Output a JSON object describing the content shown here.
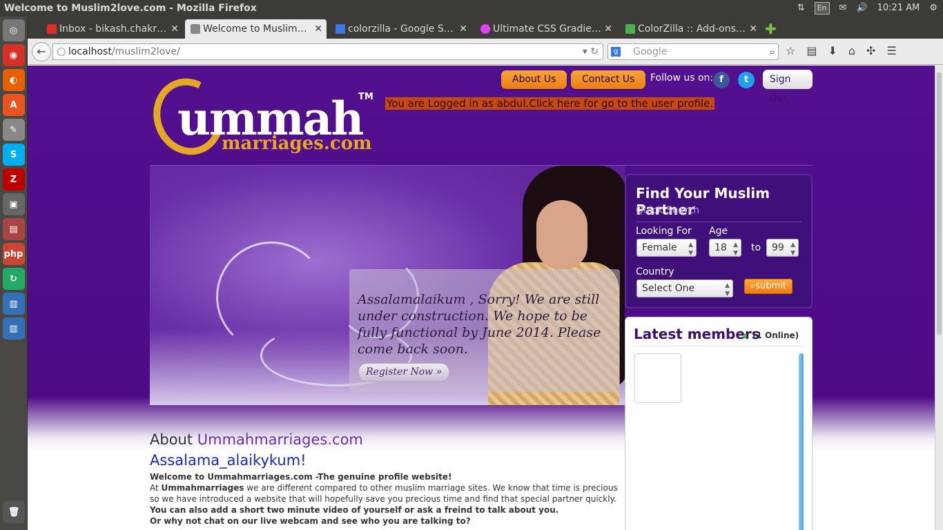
{
  "os": {
    "window_title": "Welcome to Muslim2love.com - Mozilla Firefox",
    "lang": "En",
    "time": "10:21 AM"
  },
  "tabs": [
    {
      "label": "Inbox - bikash.chakr…",
      "fav_color": "#d93025"
    },
    {
      "label": "Welcome to Muslim…",
      "fav_color": "#888888"
    },
    {
      "label": "colorzilla - Google S…",
      "fav_color": "#3b78e7"
    },
    {
      "label": "Ultimate CSS Gradie…",
      "fav_color": "#e040fb"
    },
    {
      "label": "ColorZilla :: Add-ons…",
      "fav_color": "#4caf50"
    }
  ],
  "nav": {
    "url_host": "localhost",
    "url_path": "/muslim2love/",
    "search_placeholder": "Google"
  },
  "site": {
    "logo_main": "ummah",
    "logo_tm": "TM",
    "logo_sub": "marriages.com",
    "about_btn": "About Us",
    "contact_btn": "Contact Us",
    "follow_label": "Follow us on:",
    "signout_btn": "Sign Out",
    "logged_in_msg": "You are Logged in as abdul.Click here for go to the user profile.",
    "notice": "Assalamalaikum , Sorry! We are still under construction. We hope to be fully functional by June 2014. Please come back soon.",
    "register_btn": "Register Now »"
  },
  "finder": {
    "title": "Find Your Muslim Partner",
    "subtitle": "Quick Search",
    "looking_for_label": "Looking For",
    "looking_for_value": "Female",
    "age_label": "Age",
    "age_from": "18",
    "to_label": "to",
    "age_to": "99",
    "country_label": "Country",
    "country_value": "Select One",
    "submit_label": "submit"
  },
  "members": {
    "title": "Latest members",
    "online": "(1 Online)"
  },
  "about": {
    "heading_prefix": "About ",
    "heading_site": "Ummahmarriages.com",
    "greeting": "Assalama_alaikykum!",
    "line1": "Welcome to Ummahmarriages.com -The genuine profile website!",
    "line2_a": "At ",
    "line2_b": "Ummahmarriages",
    "line2_c": " we are different compared to other muslim marriage sites. We know that  time is precious so we have introduced a website that will hopefully save you precious time and find that special partner quickly.",
    "line3": "You can also add a short two minute video of yourself or ask a freind to talk about you.",
    "line4": "Or why not chat on our live webcam and see who you are talking to?"
  }
}
